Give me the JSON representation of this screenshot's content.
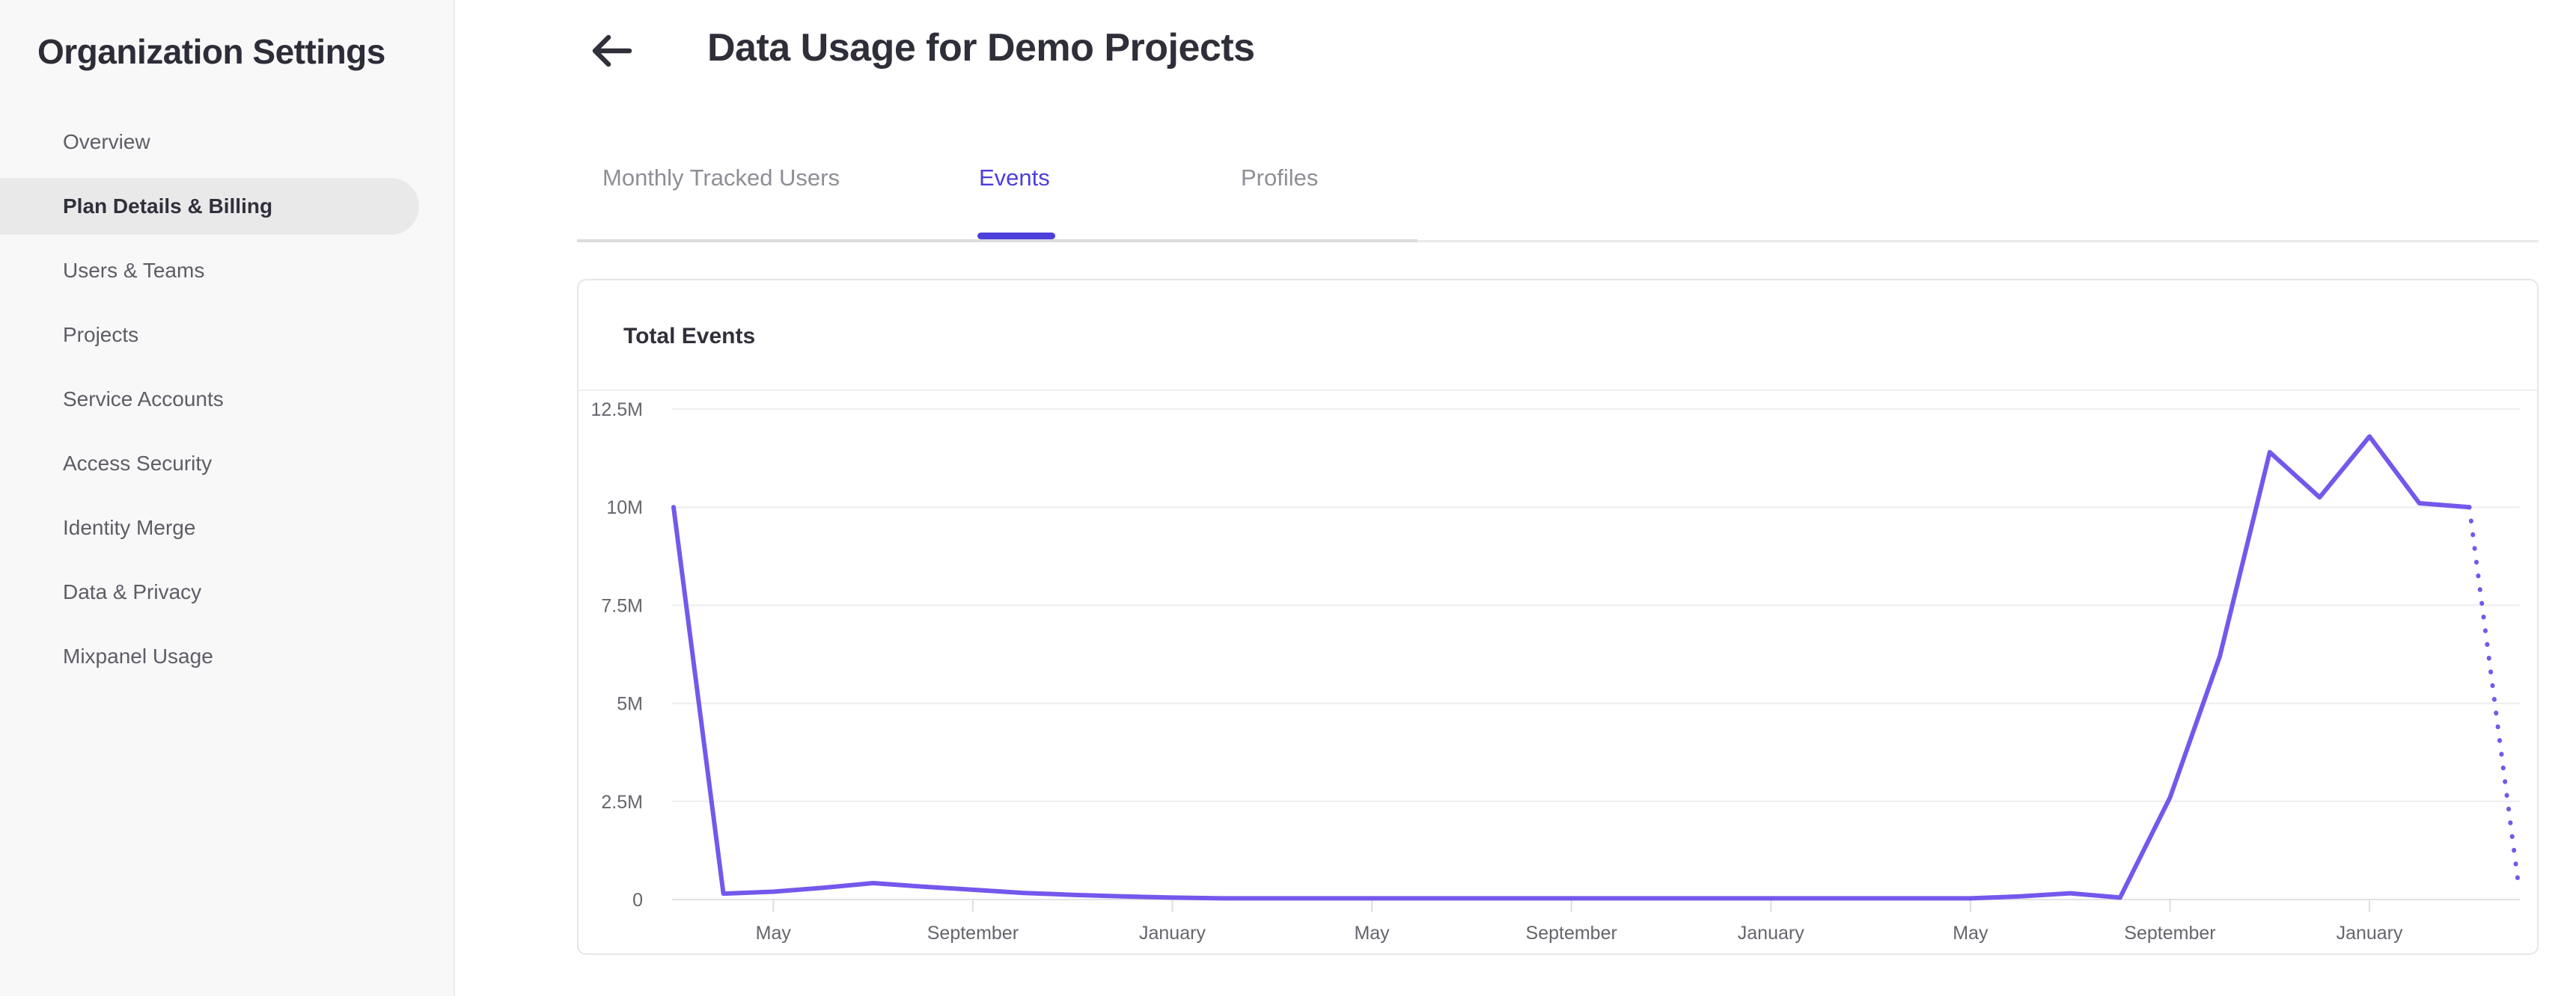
{
  "sidebar": {
    "title": "Organization Settings",
    "items": [
      {
        "label": "Overview",
        "selected": false
      },
      {
        "label": "Plan Details & Billing",
        "selected": true
      },
      {
        "label": "Users & Teams",
        "selected": false
      },
      {
        "label": "Projects",
        "selected": false
      },
      {
        "label": "Service Accounts",
        "selected": false
      },
      {
        "label": "Access Security",
        "selected": false
      },
      {
        "label": "Identity Merge",
        "selected": false
      },
      {
        "label": "Data & Privacy",
        "selected": false
      },
      {
        "label": "Mixpanel Usage",
        "selected": false
      }
    ]
  },
  "header": {
    "title": "Data Usage for Demo Projects",
    "back_icon": "arrow-left-icon"
  },
  "tabs": {
    "items": [
      {
        "label": "Monthly Tracked Users",
        "active": false
      },
      {
        "label": "Events",
        "active": true
      },
      {
        "label": "Profiles",
        "active": false
      }
    ]
  },
  "card": {
    "title": "Total Events"
  },
  "colors": {
    "accent": "#4C3FDB",
    "line": "#7458EC",
    "selected_item_bg": "#E9E9EA",
    "grid": "#EDEDEF",
    "zero_axis": "#E2E2E5",
    "tick": "#DFDFE2",
    "axis_label": "#65656D"
  },
  "chart_data": {
    "type": "line",
    "title": "Total Events",
    "series_name": "Total Events",
    "unit": "events",
    "ylim_m": [
      0,
      12.5
    ],
    "y_tick_labels": [
      "12.5M",
      "10M",
      "7.5M",
      "5M",
      "2.5M",
      "0"
    ],
    "y_tick_values_m": [
      12.5,
      10,
      7.5,
      5,
      2.5,
      0
    ],
    "x_tick_labels": [
      "May",
      "September",
      "January",
      "May",
      "September",
      "January",
      "May",
      "September",
      "January"
    ],
    "x_tick_indices": [
      2,
      6,
      10,
      14,
      18,
      22,
      26,
      30,
      34
    ],
    "months": [
      "Mar",
      "Apr",
      "May",
      "Jun",
      "Jul",
      "Aug",
      "Sep",
      "Oct",
      "Nov",
      "Dec",
      "Jan",
      "Feb",
      "Mar",
      "Apr",
      "May",
      "Jun",
      "Jul",
      "Aug",
      "Sep",
      "Oct",
      "Nov",
      "Dec",
      "Jan",
      "Feb",
      "Mar",
      "Apr",
      "May",
      "Jun",
      "Jul",
      "Aug",
      "Sep",
      "Oct",
      "Nov",
      "Dec",
      "Jan",
      "Feb",
      "Mar",
      "Apr"
    ],
    "points_monthly_millions": [
      10,
      0.15,
      0.2,
      0.3,
      0.42,
      0.33,
      0.25,
      0.17,
      0.12,
      0.08,
      0.05,
      0.03,
      0.03,
      0.03,
      0.03,
      0.03,
      0.03,
      0.03,
      0.03,
      0.03,
      0.03,
      0.03,
      0.03,
      0.03,
      0.03,
      0.03,
      0.03,
      0.08,
      0.16,
      0.05,
      2.6,
      6.2,
      11.4,
      10.25,
      11.8,
      10.1,
      10.0,
      0.25
    ],
    "last_segment_style": "dotted",
    "grid": "horizontal",
    "legend": "none",
    "line_color": "#7458EC"
  }
}
